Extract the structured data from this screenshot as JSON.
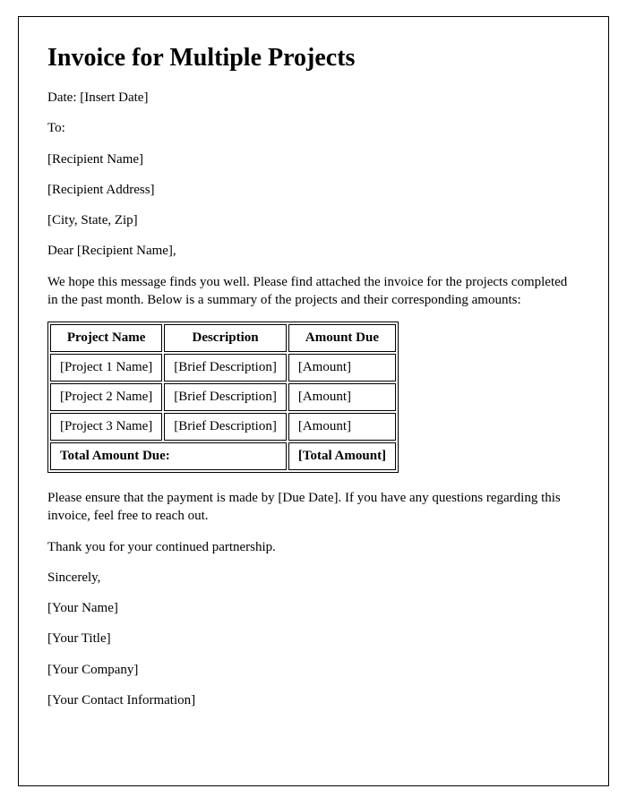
{
  "title": "Invoice for Multiple Projects",
  "date_line": "Date: [Insert Date]",
  "to_label": "To:",
  "recipient_name": "[Recipient Name]",
  "recipient_address": "[Recipient Address]",
  "recipient_city_state_zip": "[City, State, Zip]",
  "salutation": "Dear [Recipient Name],",
  "intro_paragraph": "We hope this message finds you well. Please find attached the invoice for the projects completed in the past month. Below is a summary of the projects and their corresponding amounts:",
  "table_headers": {
    "project_name": "Project Name",
    "description": "Description",
    "amount_due": "Amount Due"
  },
  "rows": [
    {
      "name": "[Project 1 Name]",
      "desc": "[Brief Description]",
      "amount": "[Amount]"
    },
    {
      "name": "[Project 2 Name]",
      "desc": "[Brief Description]",
      "amount": "[Amount]"
    },
    {
      "name": "[Project 3 Name]",
      "desc": "[Brief Description]",
      "amount": "[Amount]"
    }
  ],
  "total_label": "Total Amount Due:",
  "total_amount": "[Total Amount]",
  "payment_paragraph": "Please ensure that the payment is made by [Due Date]. If you have any questions regarding this invoice, feel free to reach out.",
  "thank_you": "Thank you for your continued partnership.",
  "signoff": "Sincerely,",
  "sender_name": "[Your Name]",
  "sender_title": "[Your Title]",
  "sender_company": "[Your Company]",
  "sender_contact": "[Your Contact Information]"
}
